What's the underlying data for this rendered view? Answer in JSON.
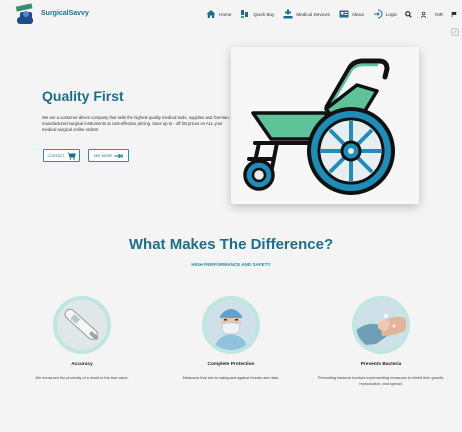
{
  "brand": {
    "name": "SurgicalSavvy"
  },
  "nav": {
    "home": "Home",
    "quick_buy": "Quick Buy",
    "medical_devices": "Medical Devices",
    "about": "About",
    "login": "Login",
    "currency": "INR"
  },
  "hero": {
    "title": "Quality First",
    "description": "We are a customer-driven company that sells the highest quality medical tools, supplies and German-manufactured surgical instruments at cost-effective pricing. Save up to - off list prices on ALL your medical surgical online orders!",
    "contact_label": "CONTACT",
    "see_more_label": "SEE MORE"
  },
  "section": {
    "title": "What Makes The Difference?",
    "subtitle": "HIGH PERFORMANCE AND SAFETY"
  },
  "features": [
    {
      "title": "Accuracy",
      "description": "We measures the proximity of a result to the true value."
    },
    {
      "title": "Complete Protection",
      "description": "Measures that aim to safeguard against threats and risks."
    },
    {
      "title": "Prevents Bacteria",
      "description": "Preventing bacteria involves implementing measures to inhibit their growth, reproduction, and spread."
    }
  ],
  "colors": {
    "primary": "#1b6f8c",
    "accent": "#1b9ba6",
    "circle_bg": "#bfe6df",
    "wheel_green": "#5fc39a"
  },
  "icons": {
    "home": "home-icon",
    "quick_buy": "quick-buy-icon",
    "medical_devices": "medical-devices-icon",
    "about": "about-icon",
    "login": "login-icon",
    "search": "search-icon",
    "user": "user-icon",
    "flag": "flag-icon"
  }
}
